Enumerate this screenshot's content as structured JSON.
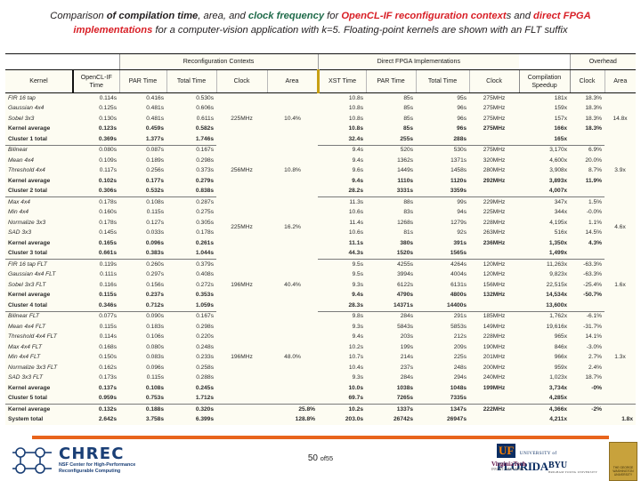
{
  "title": {
    "l1_a": "Comparison ",
    "l1_b": "of compilation time",
    "l1_c": ", area, and ",
    "l1_d": "clock frequency",
    "l1_e": " for ",
    "l1_f": "OpenCL-IF reconfiguration context",
    "l1_g": "s and ",
    "l1_h": "direct FPGA",
    "l2_a": "implementations",
    "l2_b": " for a computer-vision application with k=5. Floating-point kernels are shown with an FLT suffix"
  },
  "table": {
    "group_headers": [
      {
        "label": "",
        "span": 2
      },
      {
        "label": "Reconfiguration Contexts",
        "span": 4
      },
      {
        "label": "Direct FPGA Implementations",
        "span": 4
      },
      {
        "label": "",
        "span": 1
      },
      {
        "label": "Overhead",
        "span": 2
      }
    ],
    "columns": [
      "Kernel",
      "OpenCL-IF Time",
      "PAR Time",
      "Total Time",
      "Clock",
      "Area",
      "XST Time",
      "PAR Time",
      "Total Time",
      "Clock",
      "Compilation Speedup",
      "Clock",
      "Area"
    ],
    "blocks": [
      {
        "name": "cluster-1",
        "clock": "225MHz",
        "area": "10.4%",
        "oh_area": "14.8x",
        "rows": [
          {
            "kernel": "FIR 16 tap",
            "ocl": "0.114s",
            "par": "0.416s",
            "tot": "0.530s",
            "xst": "10.8s",
            "dpar": "85s",
            "dtot": "95s",
            "dclk": "275MHz",
            "speedup": "181x",
            "oh_clock": "18.3%",
            "bold": false
          },
          {
            "kernel": "Gaussian 4x4",
            "ocl": "0.125s",
            "par": "0.481s",
            "tot": "0.606s",
            "xst": "10.8s",
            "dpar": "85s",
            "dtot": "96s",
            "dclk": "275MHz",
            "speedup": "159x",
            "oh_clock": "18.3%",
            "bold": false
          },
          {
            "kernel": "Sobel 3x3",
            "ocl": "0.130s",
            "par": "0.481s",
            "tot": "0.611s",
            "xst": "10.8s",
            "dpar": "85s",
            "dtot": "96s",
            "dclk": "275MHz",
            "speedup": "157x",
            "oh_clock": "18.3%",
            "bold": false
          },
          {
            "kernel": "Kernel average",
            "ocl": "0.123s",
            "par": "0.459s",
            "tot": "0.582s",
            "xst": "10.8s",
            "dpar": "85s",
            "dtot": "96s",
            "dclk": "275MHz",
            "speedup": "166x",
            "oh_clock": "18.3%",
            "bold": true
          },
          {
            "kernel": "Cluster 1 total",
            "ocl": "0.369s",
            "par": "1.377s",
            "tot": "1.746s",
            "xst": "32.4s",
            "dpar": "255s",
            "dtot": "288s",
            "dclk": "",
            "speedup": "165x",
            "oh_clock": "",
            "bold": true
          }
        ]
      },
      {
        "name": "cluster-2",
        "clock": "256MHz",
        "area": "10.8%",
        "oh_area": "3.9x",
        "rows": [
          {
            "kernel": "Bilinear",
            "ocl": "0.080s",
            "par": "0.087s",
            "tot": "0.167s",
            "xst": "9.4s",
            "dpar": "520s",
            "dtot": "530s",
            "dclk": "275MHz",
            "speedup": "3,170x",
            "oh_clock": "6.9%",
            "bold": false
          },
          {
            "kernel": "Mean 4x4",
            "ocl": "0.109s",
            "par": "0.189s",
            "tot": "0.298s",
            "xst": "9.4s",
            "dpar": "1362s",
            "dtot": "1371s",
            "dclk": "320MHz",
            "speedup": "4,600x",
            "oh_clock": "20.0%",
            "bold": false
          },
          {
            "kernel": "Threshold 4x4",
            "ocl": "0.117s",
            "par": "0.256s",
            "tot": "0.373s",
            "xst": "9.6s",
            "dpar": "1449s",
            "dtot": "1458s",
            "dclk": "280MHz",
            "speedup": "3,908x",
            "oh_clock": "8.7%",
            "bold": false
          },
          {
            "kernel": "Kernel average",
            "ocl": "0.102s",
            "par": "0.177s",
            "tot": "0.279s",
            "xst": "9.4s",
            "dpar": "1110s",
            "dtot": "1120s",
            "dclk": "292MHz",
            "speedup": "3,893x",
            "oh_clock": "11.9%",
            "bold": true
          },
          {
            "kernel": "Cluster 2 total",
            "ocl": "0.306s",
            "par": "0.532s",
            "tot": "0.838s",
            "xst": "28.2s",
            "dpar": "3331s",
            "dtot": "3359s",
            "dclk": "",
            "speedup": "4,007x",
            "oh_clock": "",
            "bold": true
          }
        ]
      },
      {
        "name": "cluster-3",
        "clock": "225MHz",
        "area": "16.2%",
        "oh_area": "4.6x",
        "rows": [
          {
            "kernel": "Max 4x4",
            "ocl": "0.178s",
            "par": "0.108s",
            "tot": "0.287s",
            "xst": "11.3s",
            "dpar": "88s",
            "dtot": "99s",
            "dclk": "229MHz",
            "speedup": "347x",
            "oh_clock": "1.5%",
            "bold": false
          },
          {
            "kernel": "Min 4x4",
            "ocl": "0.160s",
            "par": "0.115s",
            "tot": "0.275s",
            "xst": "10.6s",
            "dpar": "83s",
            "dtot": "94s",
            "dclk": "225MHz",
            "speedup": "344x",
            "oh_clock": "-0.0%",
            "bold": false
          },
          {
            "kernel": "Normalize 3x3",
            "ocl": "0.178s",
            "par": "0.127s",
            "tot": "0.305s",
            "xst": "11.4s",
            "dpar": "1268s",
            "dtot": "1279s",
            "dclk": "228MHz",
            "speedup": "4,195x",
            "oh_clock": "1.1%",
            "bold": false
          },
          {
            "kernel": "SAD 3x3",
            "ocl": "0.145s",
            "par": "0.033s",
            "tot": "0.178s",
            "xst": "10.6s",
            "dpar": "81s",
            "dtot": "92s",
            "dclk": "263MHz",
            "speedup": "516x",
            "oh_clock": "14.5%",
            "bold": false
          },
          {
            "kernel": "Kernel average",
            "ocl": "0.165s",
            "par": "0.096s",
            "tot": "0.261s",
            "xst": "11.1s",
            "dpar": "380s",
            "dtot": "391s",
            "dclk": "236MHz",
            "speedup": "1,350x",
            "oh_clock": "4.3%",
            "bold": true
          },
          {
            "kernel": "Cluster 3 total",
            "ocl": "0.661s",
            "par": "0.383s",
            "tot": "1.044s",
            "xst": "44.3s",
            "dpar": "1520s",
            "dtot": "1565s",
            "dclk": "",
            "speedup": "1,499x",
            "oh_clock": "",
            "bold": true
          }
        ]
      },
      {
        "name": "cluster-4",
        "clock": "196MHz",
        "area": "40.4%",
        "oh_area": "1.6x",
        "rows": [
          {
            "kernel": "FIR 16 tap FLT",
            "ocl": "0.119s",
            "par": "0.260s",
            "tot": "0.379s",
            "xst": "9.5s",
            "dpar": "4255s",
            "dtot": "4264s",
            "dclk": "120MHz",
            "speedup": "11,263x",
            "oh_clock": "-63.3%",
            "bold": false
          },
          {
            "kernel": "Gaussian 4x4 FLT",
            "ocl": "0.111s",
            "par": "0.297s",
            "tot": "0.408s",
            "xst": "9.5s",
            "dpar": "3994s",
            "dtot": "4004s",
            "dclk": "120MHz",
            "speedup": "9,823x",
            "oh_clock": "-63.3%",
            "bold": false
          },
          {
            "kernel": "Sobel 3x3 FLT",
            "ocl": "0.116s",
            "par": "0.156s",
            "tot": "0.272s",
            "xst": "9.3s",
            "dpar": "6122s",
            "dtot": "6131s",
            "dclk": "156MHz",
            "speedup": "22,515x",
            "oh_clock": "-25.4%",
            "bold": false
          },
          {
            "kernel": "Kernel average",
            "ocl": "0.115s",
            "par": "0.237s",
            "tot": "0.353s",
            "xst": "9.4s",
            "dpar": "4790s",
            "dtot": "4800s",
            "dclk": "132MHz",
            "speedup": "14,534x",
            "oh_clock": "-50.7%",
            "bold": true
          },
          {
            "kernel": "Cluster 4 total",
            "ocl": "0.346s",
            "par": "0.712s",
            "tot": "1.059s",
            "xst": "28.3s",
            "dpar": "14371s",
            "dtot": "14400s",
            "dclk": "",
            "speedup": "13,600x",
            "oh_clock": "",
            "bold": true
          }
        ]
      },
      {
        "name": "cluster-5",
        "clock": "196MHz",
        "area": "48.0%",
        "oh_area": "1.3x",
        "rows": [
          {
            "kernel": "Bilinear FLT",
            "ocl": "0.077s",
            "par": "0.090s",
            "tot": "0.167s",
            "xst": "9.8s",
            "dpar": "284s",
            "dtot": "291s",
            "dclk": "185MHz",
            "speedup": "1,762x",
            "oh_clock": "-6.1%",
            "bold": false
          },
          {
            "kernel": "Mean 4x4 FLT",
            "ocl": "0.115s",
            "par": "0.183s",
            "tot": "0.298s",
            "xst": "9.3s",
            "dpar": "5843s",
            "dtot": "5853s",
            "dclk": "149MHz",
            "speedup": "19,616x",
            "oh_clock": "-31.7%",
            "bold": false
          },
          {
            "kernel": "Threshold 4x4 FLT",
            "ocl": "0.114s",
            "par": "0.106s",
            "tot": "0.220s",
            "xst": "9.4s",
            "dpar": "203s",
            "dtot": "212s",
            "dclk": "228MHz",
            "speedup": "965x",
            "oh_clock": "14.1%",
            "bold": false
          },
          {
            "kernel": "Max 4x4 FLT",
            "ocl": "0.168s",
            "par": "0.080s",
            "tot": "0.248s",
            "xst": "10.2s",
            "dpar": "199s",
            "dtot": "209s",
            "dclk": "190MHz",
            "speedup": "846x",
            "oh_clock": "-3.0%",
            "bold": false
          },
          {
            "kernel": "Min 4x4 FLT",
            "ocl": "0.150s",
            "par": "0.083s",
            "tot": "0.233s",
            "xst": "10.7s",
            "dpar": "214s",
            "dtot": "225s",
            "dclk": "201MHz",
            "speedup": "966x",
            "oh_clock": "2.7%",
            "bold": false
          },
          {
            "kernel": "Normalize 3x3 FLT",
            "ocl": "0.162s",
            "par": "0.096s",
            "tot": "0.258s",
            "xst": "10.4s",
            "dpar": "237s",
            "dtot": "248s",
            "dclk": "200MHz",
            "speedup": "959x",
            "oh_clock": "2.4%",
            "bold": false
          },
          {
            "kernel": "SAD 3x3 FLT",
            "ocl": "0.173s",
            "par": "0.115s",
            "tot": "0.288s",
            "xst": "9.3s",
            "dpar": "284s",
            "dtot": "294s",
            "dclk": "240MHz",
            "speedup": "1,023x",
            "oh_clock": "18.7%",
            "bold": false
          },
          {
            "kernel": "Kernel average",
            "ocl": "0.137s",
            "par": "0.108s",
            "tot": "0.245s",
            "xst": "10.0s",
            "dpar": "1038s",
            "dtot": "1048s",
            "dclk": "199MHz",
            "speedup": "3,734x",
            "oh_clock": "-0%",
            "bold": true
          },
          {
            "kernel": "Cluster 5 total",
            "ocl": "0.959s",
            "par": "0.753s",
            "tot": "1.712s",
            "xst": "69.7s",
            "dpar": "7265s",
            "dtot": "7335s",
            "dclk": "",
            "speedup": "4,285x",
            "oh_clock": "",
            "bold": true
          }
        ]
      }
    ],
    "summary": [
      {
        "kernel": "Kernel average",
        "ocl": "0.132s",
        "par": "0.188s",
        "tot": "0.320s",
        "clock": "",
        "area": "25.8%",
        "xst": "10.2s",
        "dpar": "1337s",
        "dtot": "1347s",
        "dclk": "222MHz",
        "speedup": "4,366x",
        "oh_clock": "-2%",
        "oh_area": ""
      },
      {
        "kernel": "System total",
        "ocl": "2.642s",
        "par": "3.758s",
        "tot": "6.399s",
        "clock": "",
        "area": "128.8%",
        "xst": "203.0s",
        "dpar": "26742s",
        "dtot": "26947s",
        "dclk": "",
        "speedup": "4,211x",
        "oh_clock": "",
        "oh_area": "1.8x"
      }
    ]
  },
  "footer": {
    "chrec_word": "CHREC",
    "chrec_sub1": "NSF Center for High-Performance",
    "chrec_sub2": "Reconfigurable Computing",
    "page_num": "50",
    "page_of": "of",
    "page_total": "55",
    "uf_mark": "UF",
    "uf_university": "UNIVERSITY of",
    "uf_florida": "FLORIDA",
    "vt_name": "Virginia",
    "vt_tech": "Tech",
    "vt_sub": "INVENT THE FUTURE",
    "byu_name": "BYU",
    "byu_sub": "BRIGHAM YOUNG UNIVERSITY",
    "gw_sub": "THE GEORGE WASHINGTON UNIVERSITY"
  },
  "colors": {
    "accent_orange": "#e8641c",
    "gold_divider": "#c8a014",
    "title_green": "#1f6b4a",
    "title_red": "#d81f26",
    "table_bg": "#fdfcf2"
  }
}
